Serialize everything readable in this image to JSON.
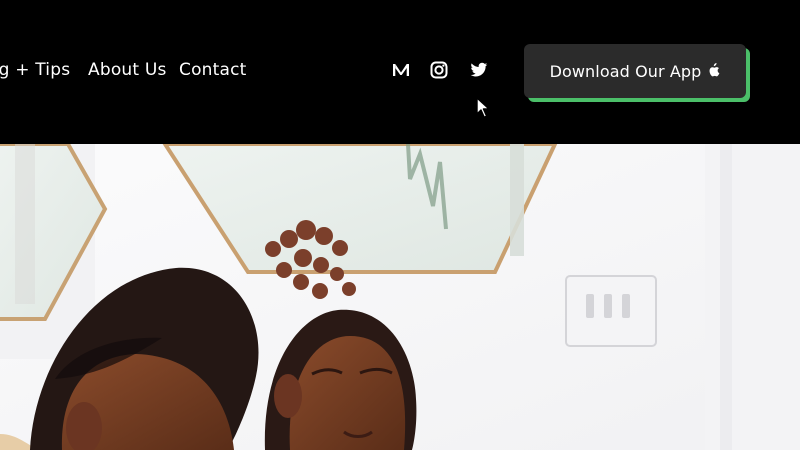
{
  "header": {
    "nav": [
      {
        "label": "og + Tips"
      },
      {
        "label": "About Us"
      },
      {
        "label": "Contact"
      }
    ],
    "social_icons": [
      "medium-icon",
      "instagram-icon",
      "twitter-icon"
    ],
    "cta": {
      "label": "Download Our App",
      "icon": "apple-icon"
    }
  },
  "colors": {
    "topbar_bg": "#000000",
    "cta_bg": "#2b2b2b",
    "cta_accent": "#4bbf69",
    "text_light": "#ffffff",
    "hero_bg": "#f7f7f8"
  }
}
